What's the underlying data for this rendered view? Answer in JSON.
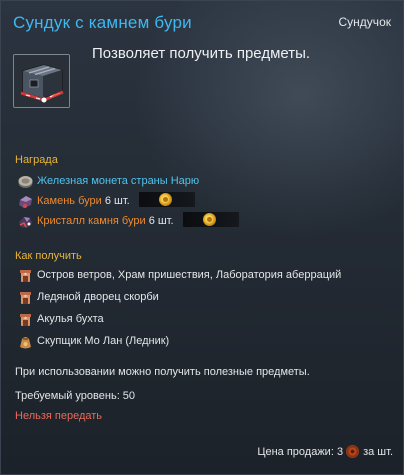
{
  "header": {
    "title": "Сундук с камнем бури",
    "item_type": "Сундучок"
  },
  "item": {
    "icon": "storm-stone-chest-icon",
    "description": "Позволяет получить предметы."
  },
  "rewards": {
    "heading": "Награда",
    "items": [
      {
        "icon": "iron-coin-icon",
        "name": "Железная монета страны Нарю",
        "quantity": ""
      },
      {
        "icon": "storm-stone-icon",
        "name": "Камень бури",
        "quantity": "6 шт."
      },
      {
        "icon": "storm-stone-crystal-icon",
        "name": "Кристалл камня бури",
        "quantity": "6 шт."
      }
    ]
  },
  "obtain": {
    "heading": "Как получить",
    "sources": [
      {
        "icon": "dungeon-icon",
        "text": "Остров ветров, Храм пришествия, Лаборатория аберраций"
      },
      {
        "icon": "dungeon-icon",
        "text": "Ледяной дворец скорби"
      },
      {
        "icon": "dungeon-icon",
        "text": "Акулья бухта"
      },
      {
        "icon": "merchant-icon",
        "text": "Скупщик Мо Лан (Ледник)"
      }
    ]
  },
  "info": {
    "use_text": "При использовании можно получить полезные предметы.",
    "level_text": "Требуемый уровень: 50",
    "trade_text": "Нельзя передать"
  },
  "price": {
    "label": "Цена продажи:",
    "amount": "3",
    "currency_icon": "copper-coin-icon",
    "suffix": "за шт."
  },
  "colors": {
    "title": "#3fb8f0",
    "section_heading": "#e8b43a",
    "reward_name_common": "#4fc4ee",
    "reward_name_rare": "#ef8a2c",
    "untradeable": "#e86a5a"
  }
}
